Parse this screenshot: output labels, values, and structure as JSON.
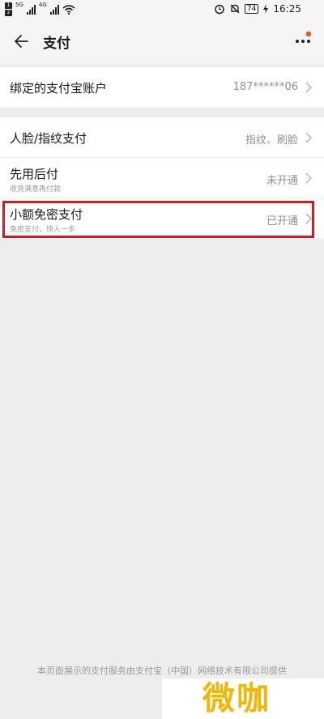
{
  "status_bar": {
    "sim1": "HD 1",
    "sim2": "HD 2",
    "network1": "5G",
    "network2": "4G",
    "battery": "74",
    "time": "16:25",
    "icons": [
      "alarm-icon",
      "mute-bell-icon",
      "charging-icon",
      "wifi-icon"
    ]
  },
  "header": {
    "title": "支付",
    "back_icon": "arrow-left-icon",
    "more_icon": "more-dots-icon",
    "notification_dot_color": "#e8591a"
  },
  "sections": [
    {
      "rows": [
        {
          "label": "绑定的支付宝账户",
          "value": "187******06"
        }
      ]
    },
    {
      "rows": [
        {
          "label": "人脸/指纹支付",
          "value": "指纹、刷脸"
        },
        {
          "label": "先用后付",
          "sub": "收货满意再付款",
          "value": "未开通"
        },
        {
          "label": "小额免密支付",
          "sub": "免密支付，快人一步",
          "value": "已开通"
        }
      ]
    }
  ],
  "highlight_color": "#d71920",
  "footer": {
    "text": "本页面展示的支付服务由支付宝（中国）网络技术有限公司提供"
  },
  "watermark": {
    "text": "微咖"
  }
}
